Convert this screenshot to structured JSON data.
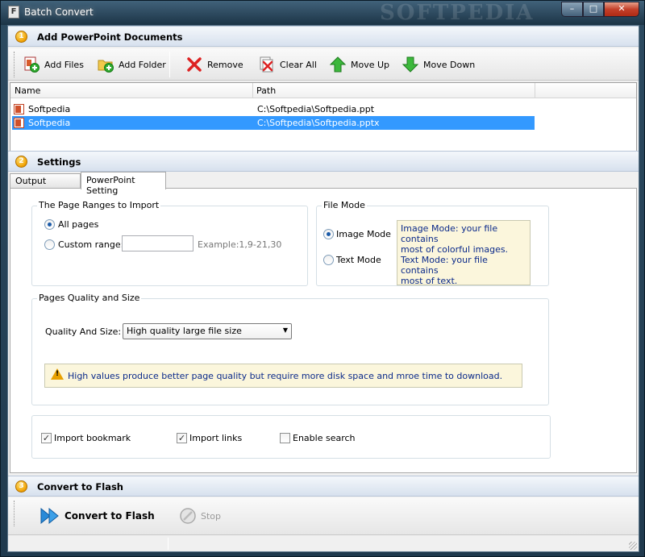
{
  "window": {
    "title": "Batch Convert",
    "watermark": "SOFTPEDIA",
    "buttons": {
      "minimize": "–",
      "maximize": "□",
      "close": "✕"
    }
  },
  "sections": {
    "add": {
      "num": "1",
      "label": "Add PowerPoint Documents"
    },
    "settings": {
      "num": "2",
      "label": "Settings"
    },
    "convert": {
      "num": "3",
      "label": "Convert to Flash"
    }
  },
  "toolbar": {
    "add_files": "Add Files",
    "add_folder": "Add Folder",
    "remove": "Remove",
    "clear_all": "Clear All",
    "move_up": "Move Up",
    "move_down": "Move Down"
  },
  "file_list": {
    "columns": [
      "Name",
      "Path"
    ],
    "rows": [
      {
        "name": "Softpedia",
        "path": "C:\\Softpedia\\Softpedia.ppt",
        "selected": false
      },
      {
        "name": "Softpedia",
        "path": "C:\\Softpedia\\Softpedia.pptx",
        "selected": true
      }
    ]
  },
  "tabs": [
    {
      "label": "Output Settings",
      "active": false
    },
    {
      "label": "PowerPoint Setting",
      "active": true
    }
  ],
  "page_ranges": {
    "title": "The Page Ranges to Import",
    "all_pages": "All pages",
    "custom_range": "Custom range:",
    "custom_value": "",
    "example": "Example:1,9-21,30",
    "selected": "all_pages"
  },
  "file_mode": {
    "title": "File Mode",
    "image_mode": "Image Mode",
    "text_mode": "Text Mode",
    "selected": "image_mode",
    "info_line1": "Image Mode: your file contains",
    "info_line2": "most of colorful images.",
    "info_line3": "Text Mode: your file contains",
    "info_line4": "most of text."
  },
  "quality": {
    "title": "Pages Quality and Size",
    "label": "Quality And Size:",
    "selected": "High quality large file size",
    "warning": "High values produce better page quality but require more disk space and mroe time to download."
  },
  "options": {
    "import_bookmark": {
      "label": "Import bookmark",
      "checked": true
    },
    "import_links": {
      "label": "Import links",
      "checked": true
    },
    "enable_search": {
      "label": "Enable search",
      "checked": false
    }
  },
  "actions": {
    "convert": "Convert to Flash",
    "stop": "Stop"
  },
  "colors": {
    "selection": "#3399ff",
    "info_bg": "#fbf6dc",
    "info_text": "#0b2a8a",
    "badge": "#f0a000"
  }
}
